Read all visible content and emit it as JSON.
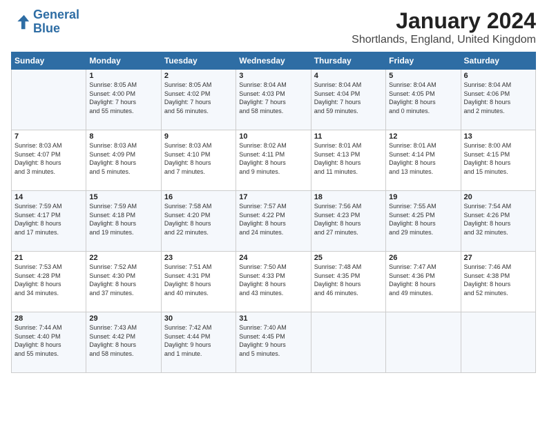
{
  "logo": {
    "line1": "General",
    "line2": "Blue"
  },
  "title": "January 2024",
  "subtitle": "Shortlands, England, United Kingdom",
  "days_of_week": [
    "Sunday",
    "Monday",
    "Tuesday",
    "Wednesday",
    "Thursday",
    "Friday",
    "Saturday"
  ],
  "weeks": [
    [
      {
        "day": "",
        "info": ""
      },
      {
        "day": "1",
        "info": "Sunrise: 8:05 AM\nSunset: 4:00 PM\nDaylight: 7 hours\nand 55 minutes."
      },
      {
        "day": "2",
        "info": "Sunrise: 8:05 AM\nSunset: 4:02 PM\nDaylight: 7 hours\nand 56 minutes."
      },
      {
        "day": "3",
        "info": "Sunrise: 8:04 AM\nSunset: 4:03 PM\nDaylight: 7 hours\nand 58 minutes."
      },
      {
        "day": "4",
        "info": "Sunrise: 8:04 AM\nSunset: 4:04 PM\nDaylight: 7 hours\nand 59 minutes."
      },
      {
        "day": "5",
        "info": "Sunrise: 8:04 AM\nSunset: 4:05 PM\nDaylight: 8 hours\nand 0 minutes."
      },
      {
        "day": "6",
        "info": "Sunrise: 8:04 AM\nSunset: 4:06 PM\nDaylight: 8 hours\nand 2 minutes."
      }
    ],
    [
      {
        "day": "7",
        "info": "Sunrise: 8:03 AM\nSunset: 4:07 PM\nDaylight: 8 hours\nand 3 minutes."
      },
      {
        "day": "8",
        "info": "Sunrise: 8:03 AM\nSunset: 4:09 PM\nDaylight: 8 hours\nand 5 minutes."
      },
      {
        "day": "9",
        "info": "Sunrise: 8:03 AM\nSunset: 4:10 PM\nDaylight: 8 hours\nand 7 minutes."
      },
      {
        "day": "10",
        "info": "Sunrise: 8:02 AM\nSunset: 4:11 PM\nDaylight: 8 hours\nand 9 minutes."
      },
      {
        "day": "11",
        "info": "Sunrise: 8:01 AM\nSunset: 4:13 PM\nDaylight: 8 hours\nand 11 minutes."
      },
      {
        "day": "12",
        "info": "Sunrise: 8:01 AM\nSunset: 4:14 PM\nDaylight: 8 hours\nand 13 minutes."
      },
      {
        "day": "13",
        "info": "Sunrise: 8:00 AM\nSunset: 4:15 PM\nDaylight: 8 hours\nand 15 minutes."
      }
    ],
    [
      {
        "day": "14",
        "info": "Sunrise: 7:59 AM\nSunset: 4:17 PM\nDaylight: 8 hours\nand 17 minutes."
      },
      {
        "day": "15",
        "info": "Sunrise: 7:59 AM\nSunset: 4:18 PM\nDaylight: 8 hours\nand 19 minutes."
      },
      {
        "day": "16",
        "info": "Sunrise: 7:58 AM\nSunset: 4:20 PM\nDaylight: 8 hours\nand 22 minutes."
      },
      {
        "day": "17",
        "info": "Sunrise: 7:57 AM\nSunset: 4:22 PM\nDaylight: 8 hours\nand 24 minutes."
      },
      {
        "day": "18",
        "info": "Sunrise: 7:56 AM\nSunset: 4:23 PM\nDaylight: 8 hours\nand 27 minutes."
      },
      {
        "day": "19",
        "info": "Sunrise: 7:55 AM\nSunset: 4:25 PM\nDaylight: 8 hours\nand 29 minutes."
      },
      {
        "day": "20",
        "info": "Sunrise: 7:54 AM\nSunset: 4:26 PM\nDaylight: 8 hours\nand 32 minutes."
      }
    ],
    [
      {
        "day": "21",
        "info": "Sunrise: 7:53 AM\nSunset: 4:28 PM\nDaylight: 8 hours\nand 34 minutes."
      },
      {
        "day": "22",
        "info": "Sunrise: 7:52 AM\nSunset: 4:30 PM\nDaylight: 8 hours\nand 37 minutes."
      },
      {
        "day": "23",
        "info": "Sunrise: 7:51 AM\nSunset: 4:31 PM\nDaylight: 8 hours\nand 40 minutes."
      },
      {
        "day": "24",
        "info": "Sunrise: 7:50 AM\nSunset: 4:33 PM\nDaylight: 8 hours\nand 43 minutes."
      },
      {
        "day": "25",
        "info": "Sunrise: 7:48 AM\nSunset: 4:35 PM\nDaylight: 8 hours\nand 46 minutes."
      },
      {
        "day": "26",
        "info": "Sunrise: 7:47 AM\nSunset: 4:36 PM\nDaylight: 8 hours\nand 49 minutes."
      },
      {
        "day": "27",
        "info": "Sunrise: 7:46 AM\nSunset: 4:38 PM\nDaylight: 8 hours\nand 52 minutes."
      }
    ],
    [
      {
        "day": "28",
        "info": "Sunrise: 7:44 AM\nSunset: 4:40 PM\nDaylight: 8 hours\nand 55 minutes."
      },
      {
        "day": "29",
        "info": "Sunrise: 7:43 AM\nSunset: 4:42 PM\nDaylight: 8 hours\nand 58 minutes."
      },
      {
        "day": "30",
        "info": "Sunrise: 7:42 AM\nSunset: 4:44 PM\nDaylight: 9 hours\nand 1 minute."
      },
      {
        "day": "31",
        "info": "Sunrise: 7:40 AM\nSunset: 4:45 PM\nDaylight: 9 hours\nand 5 minutes."
      },
      {
        "day": "",
        "info": ""
      },
      {
        "day": "",
        "info": ""
      },
      {
        "day": "",
        "info": ""
      }
    ]
  ]
}
